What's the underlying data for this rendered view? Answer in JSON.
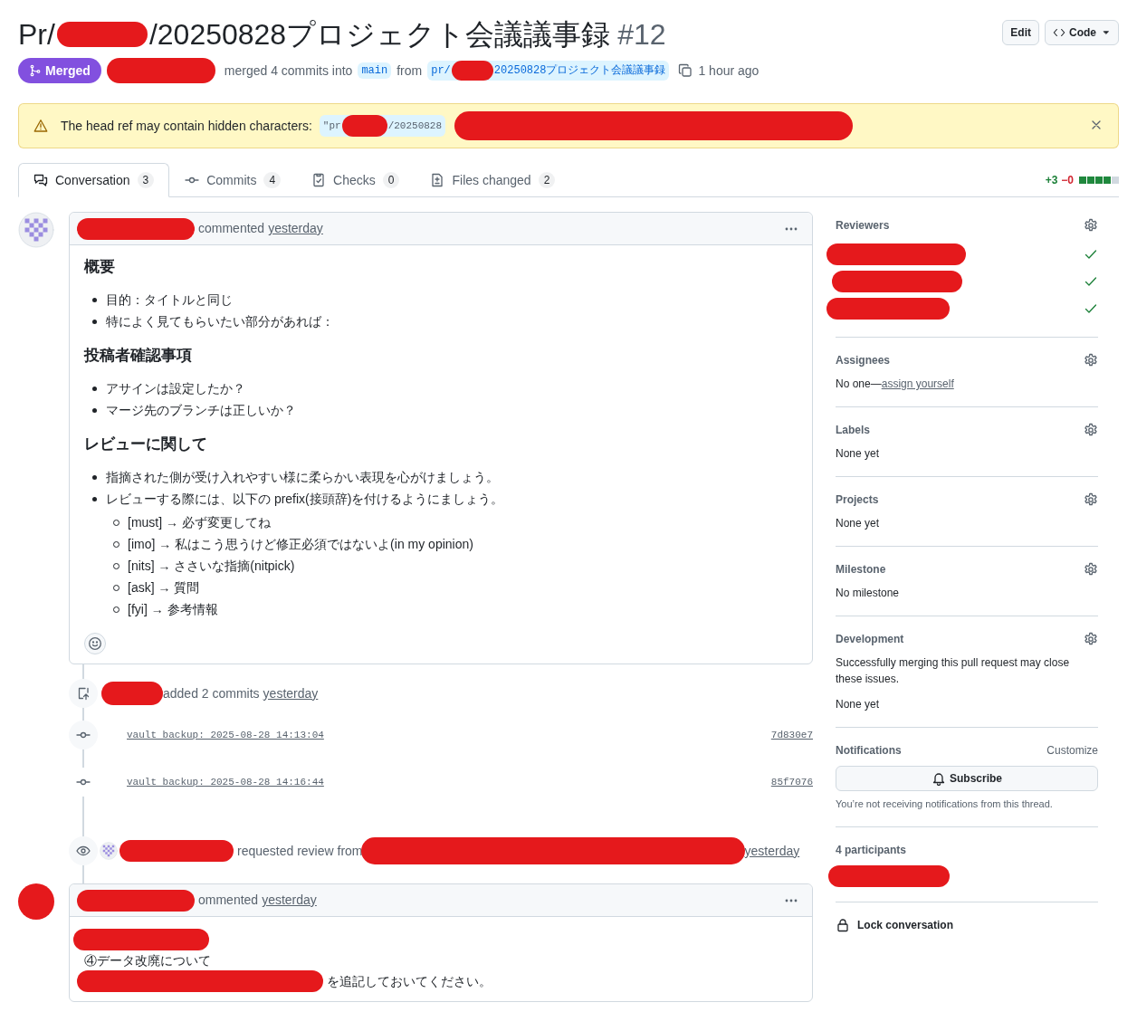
{
  "header": {
    "title_prefix": "Pr/",
    "title_suffix": "/20250828プロジェクト会議議事録",
    "number": "#12",
    "buttons": [
      {
        "label": "Edit",
        "kind": "plain"
      },
      {
        "label": "Code",
        "kind": "code"
      }
    ]
  },
  "status": {
    "state": "Merged",
    "summary": "merged 4 commits into",
    "base": "main",
    "from": "from",
    "head_prefix": "pr/",
    "head_suffix": "20250828プロジェクト会議議事録",
    "time": "1 hour ago"
  },
  "alert": {
    "text": "The head ref may contain hidden characters:",
    "ref_prefix": "\"pr",
    "ref_suffix": "/20250828"
  },
  "tabs": [
    {
      "label": "Conversation",
      "count": "3",
      "selected": true
    },
    {
      "label": "Commits",
      "count": "4",
      "selected": false
    },
    {
      "label": "Checks",
      "count": "0",
      "selected": false
    },
    {
      "label": "Files changed",
      "count": "2",
      "selected": false
    }
  ],
  "diffstat": {
    "added": "+3",
    "removed": "−0",
    "blocks": [
      {
        "color": "#1f883d"
      },
      {
        "color": "#1f883d"
      },
      {
        "color": "#1f883d"
      },
      {
        "color": "#1f883d"
      },
      {
        "color": "#d1d9e0"
      }
    ]
  },
  "timeline": [
    {
      "kind": "comment",
      "action": "commented",
      "time": "yesterday",
      "reaction": true,
      "body": [
        {
          "kind": "heading",
          "text": "概要"
        },
        {
          "kind": "list",
          "items": [
            {
              "text": "目的：タイトルと同じ"
            },
            {
              "text": "特によく見てもらいたい部分があれば："
            }
          ]
        },
        {
          "kind": "heading",
          "text": "投稿者確認事項"
        },
        {
          "kind": "list",
          "items": [
            {
              "text": "アサインは設定したか？"
            },
            {
              "text": "マージ先のブランチは正しいか？"
            }
          ]
        },
        {
          "kind": "heading",
          "text": "レビューに関して"
        },
        {
          "kind": "list",
          "items": [
            {
              "text": "指摘された側が受け入れやすい様に柔らかい表現を心がけましょう。"
            },
            {
              "text": "レビューする際には、以下の prefix(接頭辞)を付けるようにましょう。",
              "children": [
                {
                  "text": "[must] → 必ず変更してね"
                },
                {
                  "text": "[imo] → 私はこう思うけど修正必須ではないよ(in my opinion)"
                },
                {
                  "text": "[nits] → ささいな指摘(nitpick)"
                },
                {
                  "text": "[ask] → 質問"
                },
                {
                  "text": "[fyi] → 参考情報"
                }
              ]
            }
          ]
        }
      ]
    },
    {
      "kind": "commits_added",
      "text": "added 2 commits",
      "time": "yesterday"
    },
    {
      "kind": "commit",
      "message": "vault backup: 2025-08-28 14:13:04",
      "sha": "7d830e7"
    },
    {
      "kind": "commit",
      "message": "vault backup: 2025-08-28 14:16:44",
      "sha": "85f7076"
    },
    {
      "kind": "review_request",
      "text": "requested review from",
      "time": "yesterday"
    },
    {
      "kind": "comment",
      "action": "ommented",
      "time": "yesterday",
      "reaction": false,
      "body": [
        {
          "kind": "redacted_line"
        },
        {
          "kind": "paragraph",
          "text": "④データ改廃について",
          "redacted_lead": false
        },
        {
          "kind": "paragraph",
          "text": "を追記しておいてください。",
          "redacted_lead": true
        }
      ]
    }
  ],
  "sidebar": [
    {
      "kind": "reviewers",
      "title": "Reviewers",
      "gear": true,
      "reviewers": [
        {
          "approved": true
        },
        {
          "approved": true
        },
        {
          "approved": true
        }
      ]
    },
    {
      "kind": "assignees",
      "title": "Assignees",
      "gear": true,
      "text": "No one—",
      "link": "assign yourself"
    },
    {
      "kind": "plain",
      "title": "Labels",
      "gear": true,
      "text": "None yet"
    },
    {
      "kind": "plain",
      "title": "Projects",
      "gear": true,
      "text": "None yet"
    },
    {
      "kind": "plain",
      "title": "Milestone",
      "gear": true,
      "text": "No milestone"
    },
    {
      "kind": "development",
      "title": "Development",
      "gear": true,
      "note": "Successfully merging this pull request may close these issues.",
      "text": "None yet"
    },
    {
      "kind": "notifications",
      "title": "Notifications",
      "gear": false,
      "action": "Customize",
      "button": "Subscribe",
      "note": "You’re not receiving notifications from this thread."
    },
    {
      "kind": "participants",
      "title": "4 participants",
      "gear": false
    },
    {
      "kind": "lock",
      "title": "Lock conversation",
      "gear": false
    }
  ]
}
